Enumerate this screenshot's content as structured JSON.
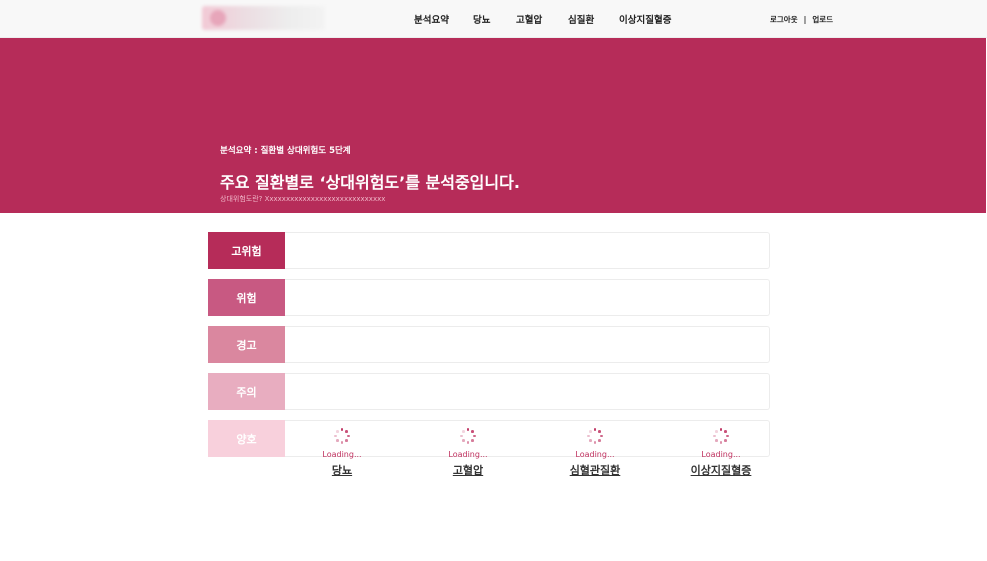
{
  "nav": {
    "menu": [
      "분석요약",
      "당뇨",
      "고혈압",
      "심질환",
      "이상지질혈증"
    ],
    "logout": "로그아웃",
    "separator": "|",
    "upload": "업로드"
  },
  "hero": {
    "subtitle": "분석요약 : 질환별 상대위험도 5단계",
    "title": "주요 질환별로 ‘상대위험도’를 분석중입니다.",
    "note": "상대위험도란? Xxxxxxxxxxxxxxxxxxxxxxxxxxxxx"
  },
  "levels": [
    {
      "label": "고위험",
      "color": "#b62c59"
    },
    {
      "label": "위험",
      "color": "#c85982"
    },
    {
      "label": "경고",
      "color": "#da879f"
    },
    {
      "label": "주의",
      "color": "#e8adc0"
    },
    {
      "label": "양호",
      "color": "#f8d0dc"
    }
  ],
  "loaders": [
    {
      "loading": "Loading...",
      "disease": "당뇨"
    },
    {
      "loading": "Loading...",
      "disease": "고혈압"
    },
    {
      "loading": "Loading...",
      "disease": "심혈관질환"
    },
    {
      "loading": "Loading...",
      "disease": "이상지질혈증"
    }
  ]
}
